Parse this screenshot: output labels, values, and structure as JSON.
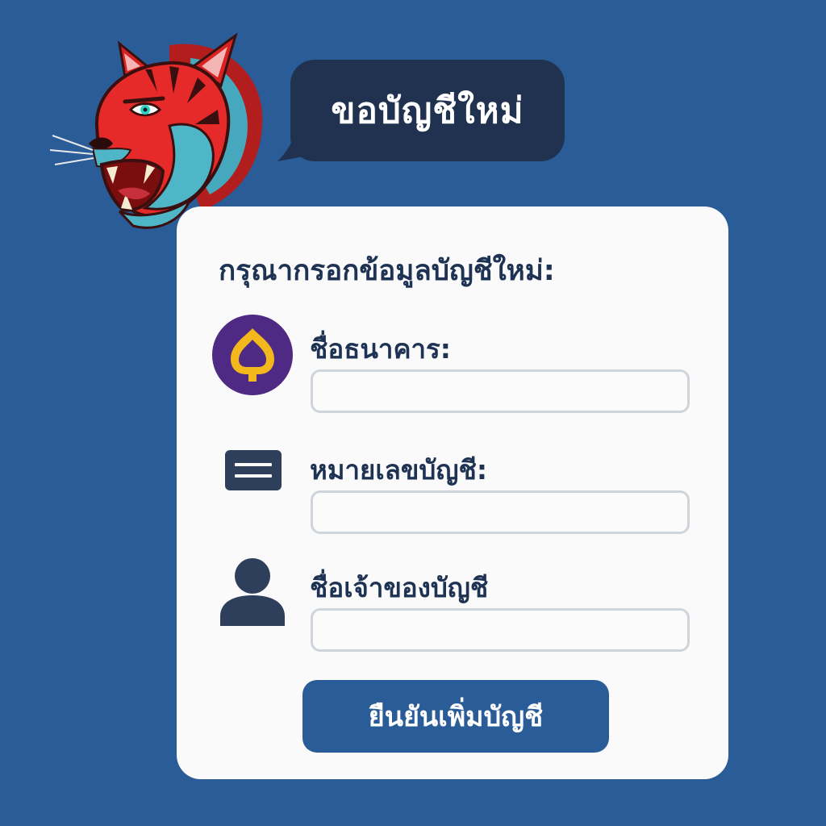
{
  "header": {
    "bubble_text": "ขอบัญชีใหม่",
    "mascot_icon": "tiger-mascot-icon"
  },
  "form": {
    "title": "กรุณากรอกข้อมูลบัญชีใหม่:",
    "fields": [
      {
        "label": "ชื่อธนาคาร:",
        "value": "",
        "icon": "bank-logo-icon"
      },
      {
        "label": "หมายเลขบัญชี:",
        "value": "",
        "icon": "card-icon"
      },
      {
        "label": "ชื่อเจ้าของบัญชี",
        "value": "",
        "icon": "user-icon"
      }
    ],
    "submit_label": "ยืนยันเพิ่มบัญชี"
  },
  "colors": {
    "background": "#2a5c98",
    "bubble": "#20324f",
    "card": "#fafafa",
    "text_dark": "#1e3354",
    "button": "#2a5c98",
    "bank_logo_purple": "#4e2a84",
    "bank_logo_gold": "#f2b81c",
    "tiger_red": "#e62a2a",
    "tiger_teal": "#4fb6c8"
  }
}
